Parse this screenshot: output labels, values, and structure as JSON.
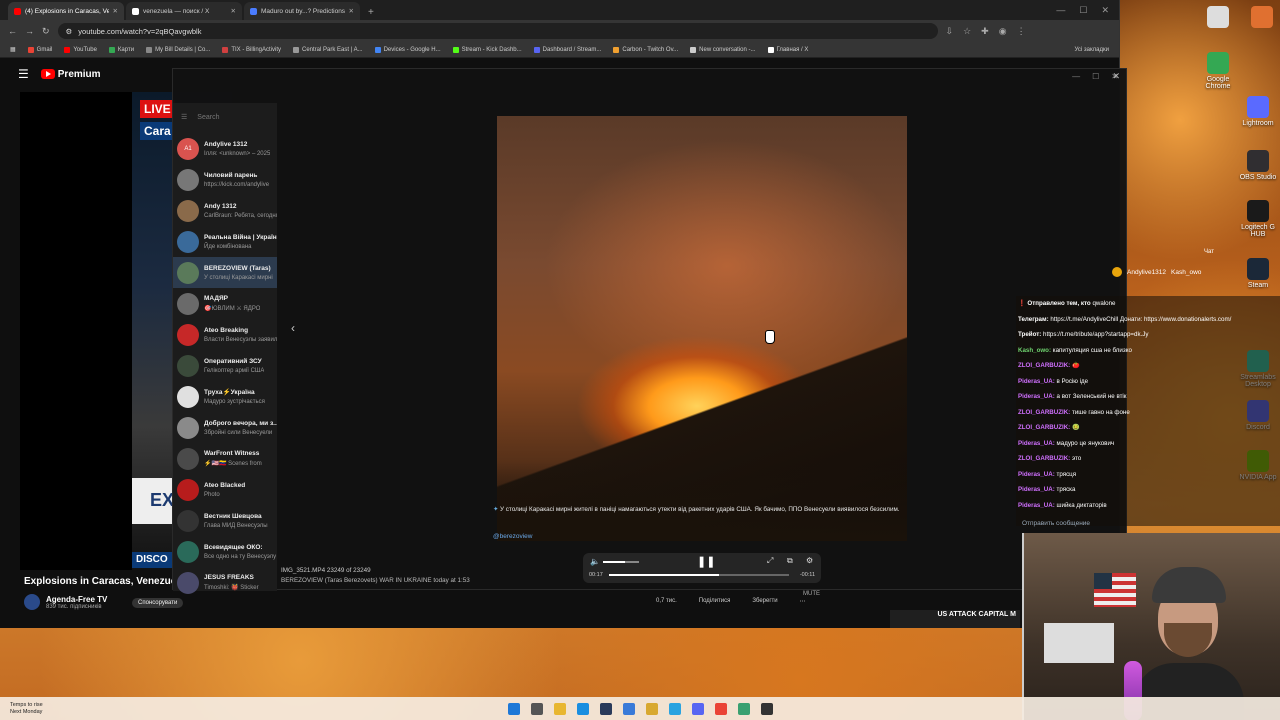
{
  "browser": {
    "tabs": [
      {
        "label": "(4) Explosions in Caracas, Ve",
        "color": "#ff0000",
        "active": true
      },
      {
        "label": "venezuela — поиск / X",
        "color": "#ffffff",
        "active": false
      },
      {
        "label": "Maduro out by...? Predictions &",
        "color": "#4a7cff",
        "active": false
      }
    ],
    "new_tab": "+",
    "url": "youtube.com/watch?v=2qBQavgwblk",
    "bookmarks": [
      {
        "label": "Gmail",
        "color": "#ea4335"
      },
      {
        "label": "YouTube",
        "color": "#ff0000"
      },
      {
        "label": "Карти",
        "color": "#34a853"
      },
      {
        "label": "My Bill Details | Co...",
        "color": "#888888"
      },
      {
        "label": "TIX - BillingActivity",
        "color": "#d04040"
      },
      {
        "label": "Central Park East | A...",
        "color": "#999999"
      },
      {
        "label": "Devices - Google H...",
        "color": "#4285f4"
      },
      {
        "label": "Stream - Kick Dashb...",
        "color": "#53fc18"
      },
      {
        "label": "Dashboard / Stream...",
        "color": "#5865f2"
      },
      {
        "label": "Carbon - Twitch Ov...",
        "color": "#f0a030"
      },
      {
        "label": "New conversation -...",
        "color": "#cccccc"
      },
      {
        "label": "Главная / X",
        "color": "#ffffff"
      }
    ],
    "bookmarks_right": "Усі закладки"
  },
  "youtube": {
    "logo_text": "Premium",
    "live_badge": "LIVE",
    "live_sub": "Cara",
    "banner_text": "EX",
    "disco_text": "DISCO",
    "title": "Explosions in Caracas, Venezuela",
    "channel": "Agenda-Free TV",
    "subscribers": "839 тис. підписників",
    "sponsor": "Спонсорувати",
    "subscribe": "Підписатися",
    "actions": [
      "0,7 тис.",
      "Поділитися",
      "Зберегти",
      "⋯"
    ],
    "ad_text": "US ATTACK CAPITAL M"
  },
  "telegram": {
    "search_placeholder": "Search",
    "chats": [
      {
        "name": "Andylive 1312",
        "preview": "Ілля: <unknown> – 2025",
        "avatar": "A1",
        "color": "#d9534f"
      },
      {
        "name": "Чиловий парень",
        "preview": "https://kick.com/andylive",
        "avatar": "",
        "color": "#777777"
      },
      {
        "name": "Andy 1312",
        "preview": "CarlBraun: Ребята, сегодня",
        "avatar": "",
        "color": "#8a6a4a"
      },
      {
        "name": "Реальна Війна | Україна",
        "preview": "Йде комбінована",
        "avatar": "",
        "color": "#3a6a9a"
      },
      {
        "name": "BEREZOVIEW (Taras)",
        "preview": "У столиці Каракасі мирні",
        "avatar": "",
        "color": "#5a7a5a"
      },
      {
        "name": "МАДЯР",
        "preview": "🎯ЮВЛИМ ⚔ ЯДРО",
        "avatar": "",
        "color": "#6a6a6a"
      },
      {
        "name": "Ateo Breaking",
        "preview": "Власти Венесуэлы заявили",
        "avatar": "",
        "color": "#c62828"
      },
      {
        "name": "Оперативний ЗСУ",
        "preview": "Гелікоптер армії США",
        "avatar": "",
        "color": "#3a4a3a"
      },
      {
        "name": "Труха⚡Україна",
        "preview": "Мадуро зустрічається",
        "avatar": "",
        "color": "#e0e0e0"
      },
      {
        "name": "Доброго вечора, ми з...",
        "preview": "Збройні сили Венесуели",
        "avatar": "",
        "color": "#8a8a8a"
      },
      {
        "name": "WarFront Witness",
        "preview": "⚡🇺🇸🇻🇪 Scenes from",
        "avatar": "",
        "color": "#4a4a4a"
      },
      {
        "name": "Ateo Blacked",
        "preview": "Photo",
        "avatar": "",
        "color": "#b71c1c"
      },
      {
        "name": "Вестник Шевцова",
        "preview": "Глава МИД Венесуэлы",
        "avatar": "",
        "color": "#333333"
      },
      {
        "name": "Всевидящее ОКО:",
        "preview": "Все одно на ту Венесуэлу",
        "avatar": "",
        "color": "#2a6a5a"
      },
      {
        "name": "JESUS FREAKS",
        "preview": "Timoshki: 👹 Sticker",
        "avatar": "",
        "color": "#4a4a6a"
      }
    ],
    "caption": "У столиці Каракасі мирні жителі в паніці намагаються утекти від ракетних ударів США. Як бачимо, ППО Венесуели виявилося безсилим.",
    "caption_handle": "@berezoview",
    "media_file": "IMG_3521.MP4 23249 of 23249",
    "media_source": "BEREZOVIEW (Taras Berezovets) WAR IN UKRAINE  today at 1:53",
    "time_current": "00:17",
    "time_remaining": "-00:11",
    "playback_progress": 0.61,
    "volume_level": 0.6,
    "mute_label": "MUTE"
  },
  "stream_chat": {
    "label": "Чат",
    "top_user": "Andylive1312",
    "top_user2": "Kash_owo",
    "lines": [
      {
        "user": "❗ Отправлено тем, кто",
        "text": "qwalone",
        "color": "#ffffff"
      },
      {
        "user": "Телеграм:",
        "text": "https://t.me/AndyliveChill Донати: https://www.donationalerts.com/",
        "color": "#ffffff"
      },
      {
        "user": "Трейот:",
        "text": "https://t.me/tribute/app?startapp=dk.Jy",
        "color": "#ffffff"
      },
      {
        "user": "Kash_owo:",
        "text": "капитуляция сша не близко",
        "color": "#6fd36f"
      },
      {
        "user": "ZLOI_GARBUZIK:",
        "text": "🍅",
        "color": "#d070ff"
      },
      {
        "user": "Pideras_UA:",
        "text": "в Росію іде",
        "color": "#d070ff"
      },
      {
        "user": "Pideras_UA:",
        "text": "а вот Зеленський не втік",
        "color": "#d070ff"
      },
      {
        "user": "ZLOI_GARBUZIK:",
        "text": "тише гавно на фоне",
        "color": "#d070ff"
      },
      {
        "user": "ZLOI_GARBUZIK:",
        "text": "🤢",
        "color": "#d070ff"
      },
      {
        "user": "Pideras_UA:",
        "text": "мадуро це янукович",
        "color": "#d070ff"
      },
      {
        "user": "ZLOI_GARBUZIK:",
        "text": "это",
        "color": "#d070ff"
      },
      {
        "user": "Pideras_UA:",
        "text": "трясця",
        "color": "#d070ff"
      },
      {
        "user": "Pideras_UA:",
        "text": "тряска",
        "color": "#d070ff"
      },
      {
        "user": "Pideras_UA:",
        "text": "шийка диктаторів",
        "color": "#d070ff"
      }
    ],
    "send_placeholder": "Отправить сообщение"
  },
  "desktop_icons": [
    {
      "label": "",
      "color": "#dddddd"
    },
    {
      "label": "",
      "color": "#e07030"
    },
    {
      "label": "Google Chrome",
      "color": "#34a853"
    },
    {
      "label": "Lightroom",
      "color": "#5a6aff"
    },
    {
      "label": "OBS Studio",
      "color": "#302e31"
    },
    {
      "label": "Logitech G HUB",
      "color": "#1a1a1a"
    },
    {
      "label": "Steam",
      "color": "#1b2838"
    },
    {
      "label": "Streamlabs Desktop",
      "color": "#31c3a2"
    },
    {
      "label": "Discord",
      "color": "#5865f2"
    },
    {
      "label": "NVIDIA App",
      "color": "#76b900"
    }
  ],
  "taskbar": {
    "weather_line1": "Temps to rise",
    "weather_line2": "Next Monday",
    "icons": [
      {
        "name": "windows-start-icon",
        "color": "#1e78d7"
      },
      {
        "name": "search-icon",
        "color": "#555555"
      },
      {
        "name": "file-explorer-icon",
        "color": "#e8b630"
      },
      {
        "name": "edge-icon",
        "color": "#1a8ee0"
      },
      {
        "name": "steam-icon",
        "color": "#2a3a5a"
      },
      {
        "name": "explorer-icon",
        "color": "#3a7ad8"
      },
      {
        "name": "folder-icon",
        "color": "#d8a830"
      },
      {
        "name": "telegram-icon",
        "color": "#2aa3e0"
      },
      {
        "name": "discord-icon",
        "color": "#5865f2"
      },
      {
        "name": "chrome-icon",
        "color": "#ea4335"
      },
      {
        "name": "app-icon",
        "color": "#3aa070"
      },
      {
        "name": "obs-icon",
        "color": "#333333"
      }
    ]
  }
}
